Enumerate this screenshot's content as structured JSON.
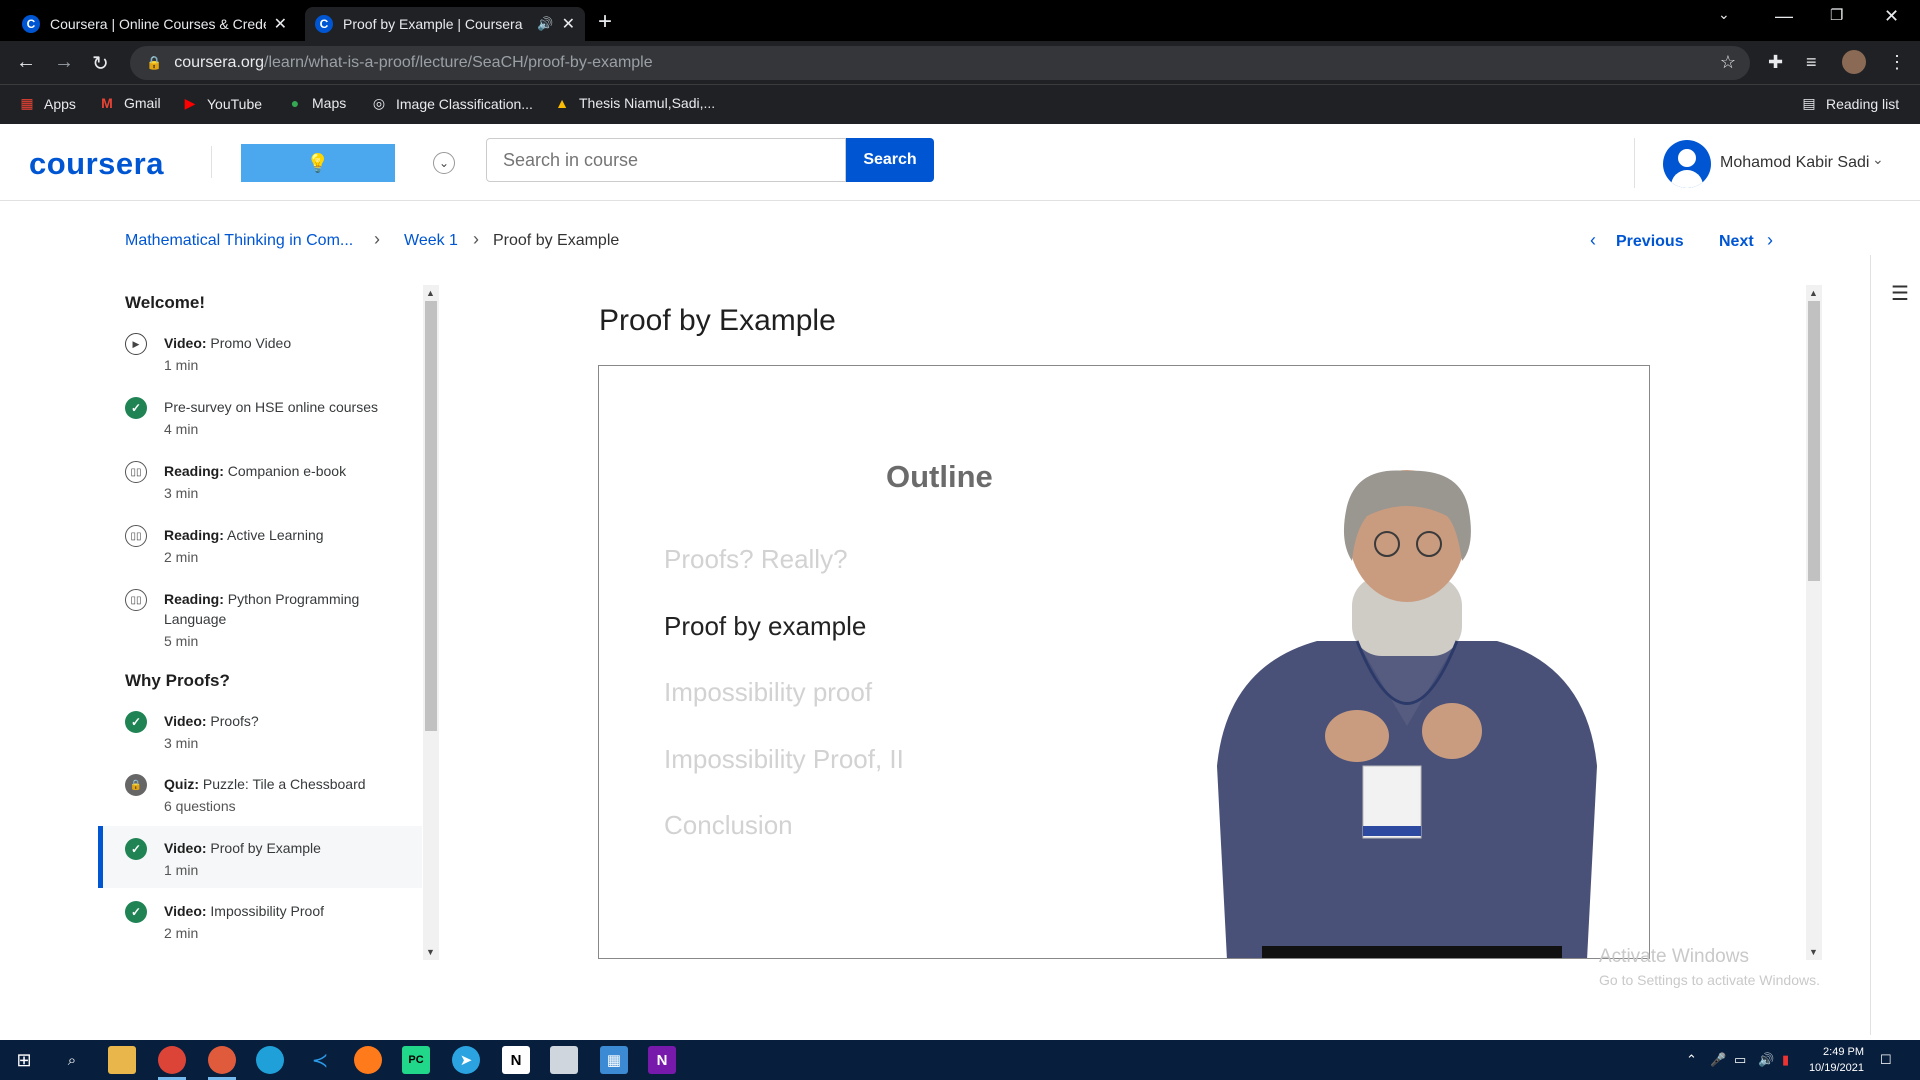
{
  "browser": {
    "tabs": [
      {
        "title": "Coursera | Online Courses & Credentials From Top Educators",
        "favicon": "C"
      },
      {
        "title": "Proof by Example | Coursera",
        "favicon": "C"
      }
    ],
    "url_host": "coursera.org",
    "url_path": "/learn/what-is-a-proof/lecture/SeaCH/proof-by-example",
    "bookmarks": [
      "Apps",
      "Gmail",
      "YouTube",
      "Maps",
      "Image Classification...",
      "Thesis Niamul,Sadi,..."
    ],
    "reading_list": "Reading list"
  },
  "header": {
    "logo": "coursera",
    "search_placeholder": "Search in course",
    "search_button": "Search",
    "user_name": "Mohamod Kabir Sadi"
  },
  "breadcrumb": {
    "course": "Mathematical Thinking in Com...",
    "week": "Week 1",
    "current": "Proof by Example",
    "previous": "Previous",
    "next": "Next"
  },
  "sidebar": {
    "sections": [
      {
        "title": "Welcome!",
        "items": [
          {
            "type": "Video:",
            "name": "Promo Video",
            "duration": "1 min",
            "icon": "play-icon"
          },
          {
            "type": "",
            "name": "Pre-survey on HSE online courses",
            "duration": "4 min",
            "icon": "check-icon"
          },
          {
            "type": "Reading:",
            "name": "Companion e-book",
            "duration": "3 min",
            "icon": "book-icon"
          },
          {
            "type": "Reading:",
            "name": "Active Learning",
            "duration": "2 min",
            "icon": "book-icon"
          },
          {
            "type": "Reading:",
            "name": "Python Programming Language",
            "duration": "5 min",
            "icon": "book-icon"
          }
        ]
      },
      {
        "title": "Why Proofs?",
        "items": [
          {
            "type": "Video:",
            "name": "Proofs?",
            "duration": "3 min",
            "icon": "check-icon"
          },
          {
            "type": "Quiz:",
            "name": "Puzzle: Tile a Chessboard",
            "duration": "6 questions",
            "icon": "lock-icon"
          },
          {
            "type": "Video:",
            "name": "Proof by Example",
            "duration": "1 min",
            "icon": "check-icon",
            "active": true
          },
          {
            "type": "Video:",
            "name": "Impossibility Proof",
            "duration": "2 min",
            "icon": "check-icon"
          }
        ]
      }
    ]
  },
  "main": {
    "title": "Proof by Example",
    "slide": {
      "heading": "Outline",
      "items": [
        "Proofs? Really?",
        "Proof by example",
        "Impossibility proof",
        "Impossibility Proof, II",
        "Conclusion"
      ],
      "current_index": 1
    }
  },
  "watermark": {
    "line1": "Activate Windows",
    "line2": "Go to Settings to activate Windows."
  },
  "taskbar": {
    "time": "2:49 PM",
    "date": "10/19/2021"
  },
  "colors": {
    "accent": "#0056d2",
    "complete": "#1f8354",
    "chrome_dark": "#202124",
    "taskbar": "#081e3d"
  }
}
